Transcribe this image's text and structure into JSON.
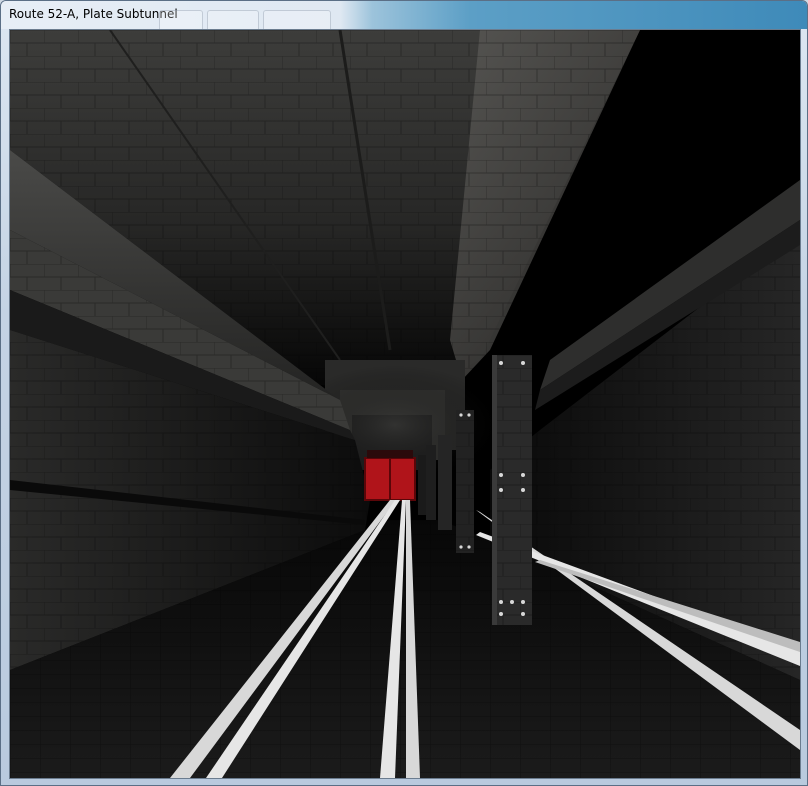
{
  "window": {
    "title": "Route 52-A, Plate Subtunnel"
  },
  "scene": {
    "end_door_color": "#b0141a",
    "rail_color": "#e6e6e6",
    "pillar_bolt_color": "#d8d8d8"
  }
}
